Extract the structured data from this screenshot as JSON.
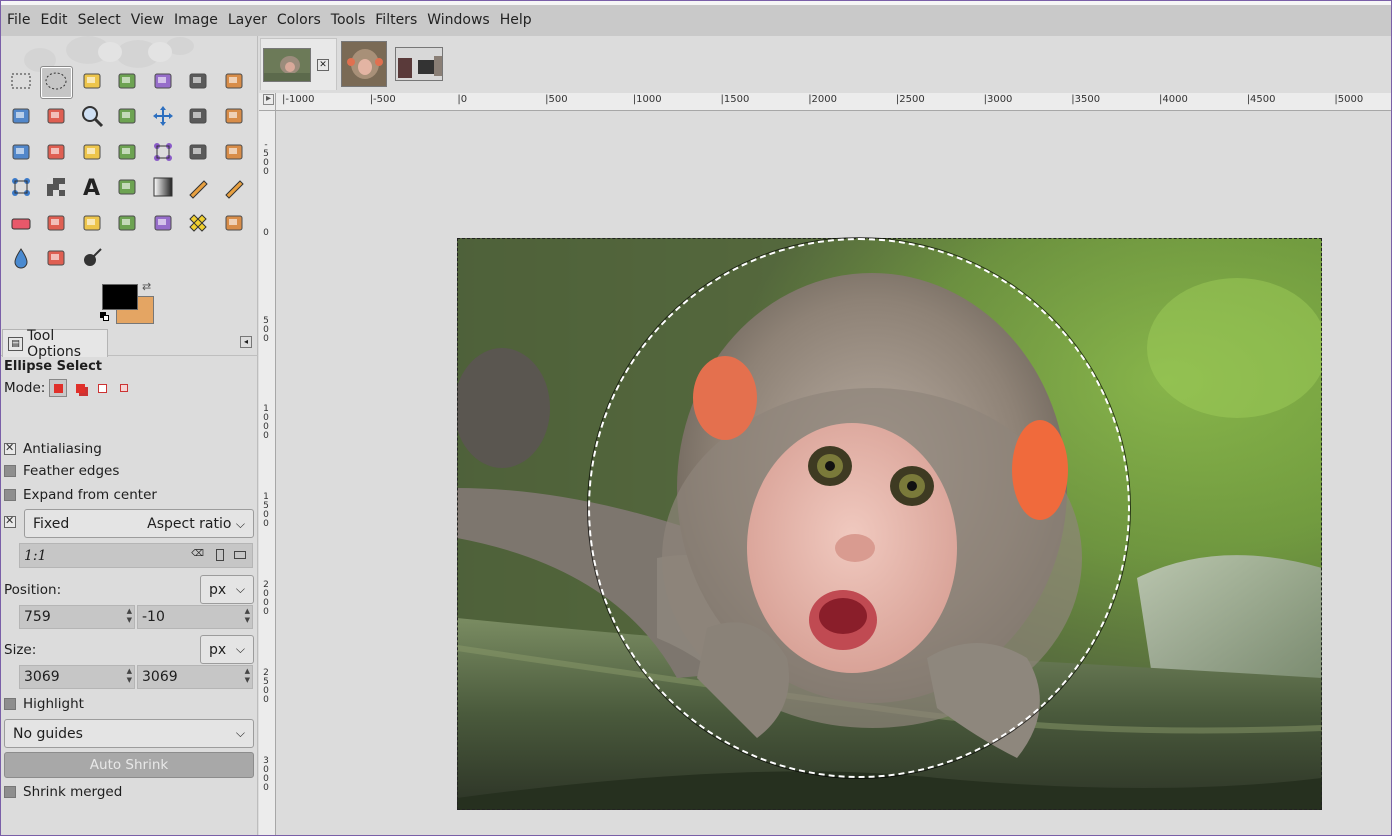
{
  "menu": [
    "File",
    "Edit",
    "Select",
    "View",
    "Image",
    "Layer",
    "Colors",
    "Tools",
    "Filters",
    "Windows",
    "Help"
  ],
  "tools": [
    {
      "name": "rect-select-icon"
    },
    {
      "name": "ellipse-select-icon",
      "active": true
    },
    {
      "name": "free-select-icon"
    },
    {
      "name": "fuzzy-select-icon"
    },
    {
      "name": "select-by-color-icon"
    },
    {
      "name": "scissors-select-icon"
    },
    {
      "name": "foreground-select-icon"
    },
    {
      "name": "paths-icon"
    },
    {
      "name": "color-picker-icon"
    },
    {
      "name": "zoom-icon"
    },
    {
      "name": "measure-icon"
    },
    {
      "name": "move-icon"
    },
    {
      "name": "alignment-icon"
    },
    {
      "name": "crop-icon"
    },
    {
      "name": "unified-transform-icon"
    },
    {
      "name": "rotate-icon"
    },
    {
      "name": "scale-icon"
    },
    {
      "name": "shear-icon"
    },
    {
      "name": "cage-transform-icon"
    },
    {
      "name": "perspective-icon"
    },
    {
      "name": "flip-icon"
    },
    {
      "name": "warp-transform-icon"
    },
    {
      "name": "handle-transform-icon"
    },
    {
      "name": "text-icon"
    },
    {
      "name": "bucket-fill-icon"
    },
    {
      "name": "gradient-icon"
    },
    {
      "name": "pencil-icon"
    },
    {
      "name": "paintbrush-icon"
    },
    {
      "name": "eraser-icon"
    },
    {
      "name": "airbrush-icon"
    },
    {
      "name": "ink-icon"
    },
    {
      "name": "mypaint-brush-icon"
    },
    {
      "name": "clone-icon"
    },
    {
      "name": "heal-icon"
    },
    {
      "name": "perspective-clone-icon"
    },
    {
      "name": "blur-sharpen-icon"
    },
    {
      "name": "smudge-icon"
    },
    {
      "name": "dodge-burn-icon"
    }
  ],
  "colors": {
    "foreground": "#000000",
    "background": "#e4a563"
  },
  "tool_options": {
    "tab_label": "Tool Options",
    "title": "Ellipse Select",
    "mode_label": "Mode:",
    "antialiasing": {
      "label": "Antialiasing",
      "checked": true
    },
    "feather_edges": {
      "label": "Feather edges",
      "checked": false
    },
    "expand_from_center": {
      "label": "Expand from center",
      "checked": false
    },
    "fixed": {
      "checked": true,
      "label": "Fixed",
      "value": "Aspect ratio"
    },
    "ratio": "1:1",
    "position": {
      "label": "Position:",
      "unit": "px",
      "x": "759",
      "y": "-10"
    },
    "size": {
      "label": "Size:",
      "unit": "px",
      "w": "3069",
      "h": "3069"
    },
    "highlight": {
      "label": "Highlight",
      "checked": false
    },
    "guides": "No guides",
    "auto_shrink": "Auto Shrink",
    "shrink_merged": {
      "label": "Shrink merged",
      "checked": false
    }
  },
  "image_tabs": [
    {
      "name": "image-tab-monkey-1",
      "active": true
    },
    {
      "name": "image-tab-monkey-2",
      "active": false
    },
    {
      "name": "image-tab-street",
      "active": false
    }
  ],
  "ruler": {
    "top_labels": [
      "-1000",
      "-500",
      "0",
      "500",
      "1000",
      "1500",
      "2000",
      "2500",
      "3000",
      "3500",
      "4000",
      "4500",
      "5000"
    ],
    "left_labels": [
      "-500",
      "0",
      "500",
      "1000",
      "1500",
      "2000",
      "2500",
      "3000"
    ]
  }
}
